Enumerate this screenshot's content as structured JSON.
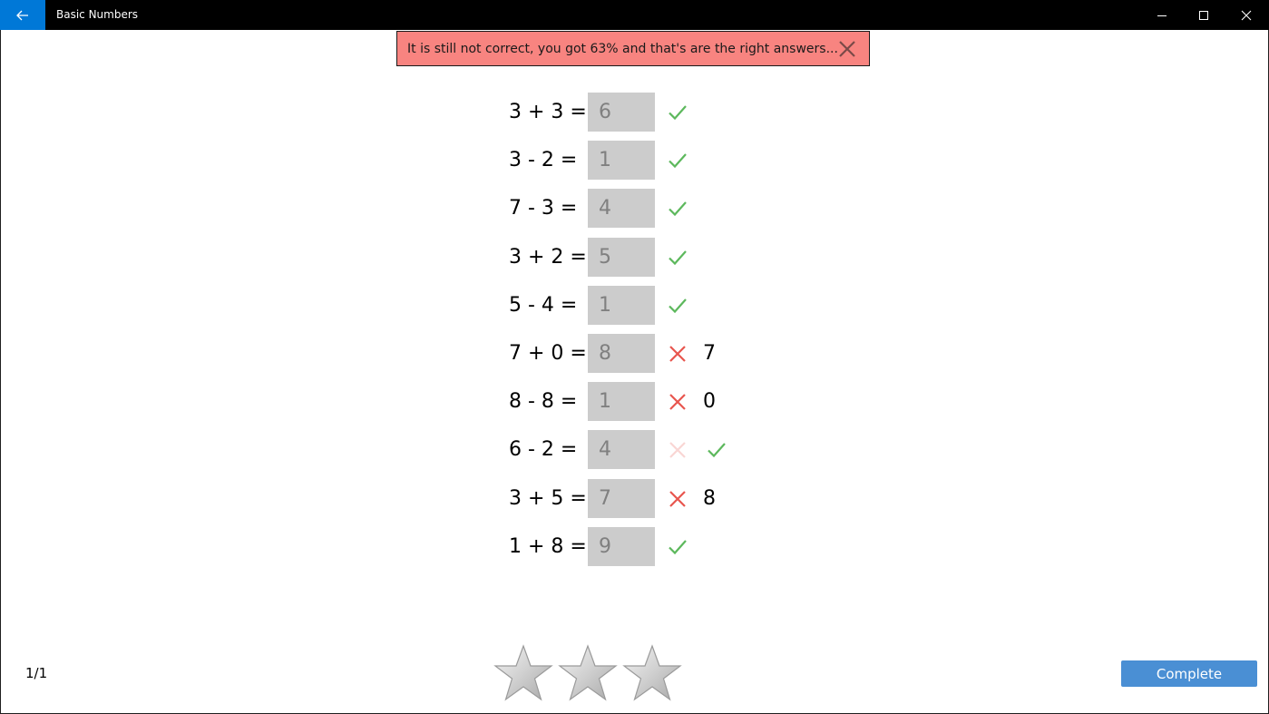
{
  "window": {
    "title": "Basic Numbers",
    "back_icon": "arrow-left-icon",
    "controls": [
      "minimize-icon",
      "maximize-icon",
      "close-icon"
    ]
  },
  "notification": {
    "text": "It is still not correct, you got 63% and that's are the right answers...",
    "close_icon": "close-icon",
    "background": "#f88480"
  },
  "problems": [
    {
      "expression": "3 + 3 =",
      "answer": "6",
      "status": "correct",
      "correction": ""
    },
    {
      "expression": "3 - 2 =",
      "answer": "1",
      "status": "correct",
      "correction": ""
    },
    {
      "expression": "7 - 3 =",
      "answer": "4",
      "status": "correct",
      "correction": ""
    },
    {
      "expression": "3 + 2 =",
      "answer": "5",
      "status": "correct",
      "correction": ""
    },
    {
      "expression": "5 - 4 =",
      "answer": "1",
      "status": "correct",
      "correction": ""
    },
    {
      "expression": "7 + 0 =",
      "answer": "8",
      "status": "wrong",
      "correction": "7"
    },
    {
      "expression": "8 - 8 =",
      "answer": "1",
      "status": "wrong",
      "correction": "0"
    },
    {
      "expression": "6 - 2 =",
      "answer": "4",
      "status": "fixed",
      "correction": ""
    },
    {
      "expression": "3 + 5 =",
      "answer": "7",
      "status": "wrong",
      "correction": "8"
    },
    {
      "expression": "1 + 8 =",
      "answer": "9",
      "status": "correct",
      "correction": ""
    }
  ],
  "colors": {
    "check": "#5cb85c",
    "cross": "#e8554e",
    "cross_faded": "#f9d6d4",
    "accent": "#0078d7",
    "button": "#4a8fd4"
  },
  "footer": {
    "page_indicator": "1/1",
    "stars_total": 3,
    "stars_filled": 0,
    "complete_label": "Complete"
  }
}
